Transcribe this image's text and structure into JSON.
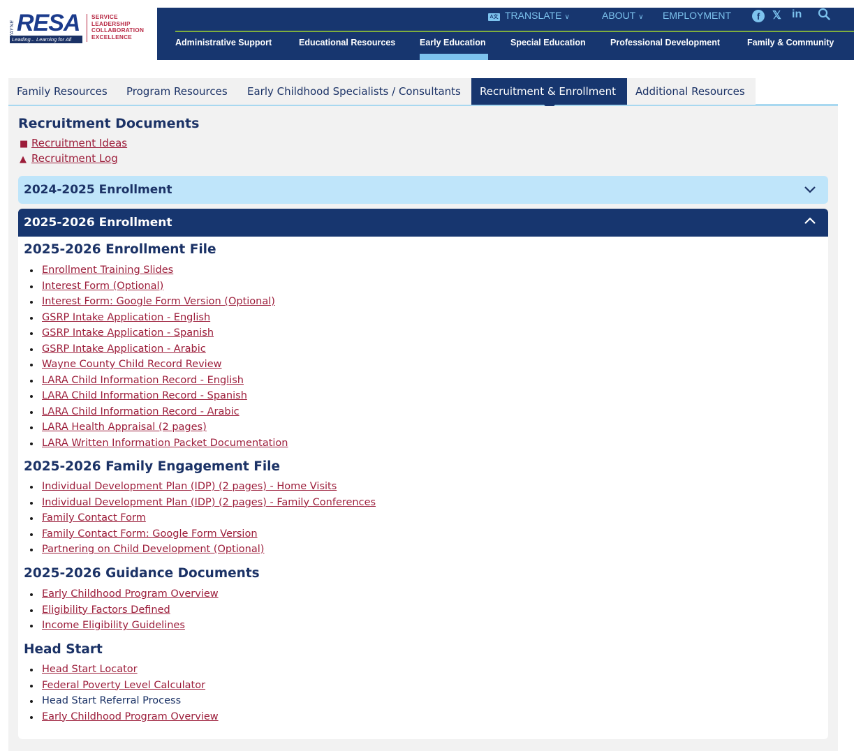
{
  "logo": {
    "side_text": "WAYNE",
    "name": "RESA",
    "tagline": "Leading... Learning for All",
    "values": [
      "SERVICE",
      "LEADERSHIP",
      "COLLABORATION",
      "EXCELLENCE"
    ]
  },
  "utility": {
    "translate": "TRANSLATE",
    "translate_icon_text": "A文",
    "about": "ABOUT",
    "employment": "EMPLOYMENT",
    "social": [
      "facebook-icon",
      "x-icon",
      "linkedin-icon"
    ],
    "linkedin_text": "in",
    "x_text": "𝕏",
    "facebook_text": "f"
  },
  "main_nav": [
    "Administrative Support",
    "Educational Resources",
    "Early Education",
    "Special Education",
    "Professional Development",
    "Family & Community"
  ],
  "tabs": [
    "Family Resources",
    "Program Resources",
    "Early Childhood Specialists / Consultants",
    "Recruitment & Enrollment",
    "Additional Resources"
  ],
  "recruitment": {
    "title": "Recruitment Documents",
    "links": [
      "Recruitment Ideas",
      "Recruitment Log"
    ]
  },
  "accordion": {
    "closed_title": "2024-2025 Enrollment",
    "open_title": "2025-2026 Enrollment"
  },
  "sections": {
    "enrollment_file": {
      "title": "2025-2026 Enrollment File",
      "items": [
        "Enrollment Training Slides",
        "Interest Form (Optional)",
        "Interest Form: Google Form Version (Optional)",
        "GSRP Intake Application - English",
        "GSRP Intake Application - Spanish",
        "GSRP Intake Application - Arabic",
        "Wayne County Child Record Review",
        "LARA Child Information Record - English",
        "LARA Child Information Record - Spanish",
        "LARA Child Information Record - Arabic",
        "LARA Health Appraisal (2 pages)",
        "LARA Written Information Packet Documentation"
      ]
    },
    "family_engagement": {
      "title": "2025-2026 Family Engagement File",
      "items": [
        "Individual Development Plan (IDP) (2 pages) - Home Visits",
        "Individual Development Plan (IDP) (2 pages) - Family Conferences",
        "Family Contact Form",
        "Family Contact Form: Google Form Version",
        "Partnering on Child Development (Optional)"
      ]
    },
    "guidance": {
      "title": "2025-2026 Guidance Documents",
      "items": [
        "Early Childhood Program Overview",
        "Eligibility Factors Defined",
        "Income Eligibility Guidelines"
      ]
    },
    "head_start": {
      "title": "Head Start",
      "items": [
        "Head Start Locator",
        "Federal Poverty Level Calculator",
        "Head Start Referral Process",
        "Early Childhood Program Overview"
      ]
    }
  },
  "colors": {
    "navy": "#17366f",
    "link_red": "#9c1d3a",
    "light_blue": "#7dc3ee",
    "accordion_closed": "#bfe5fa",
    "nav_green_line": "#7fae3e"
  }
}
